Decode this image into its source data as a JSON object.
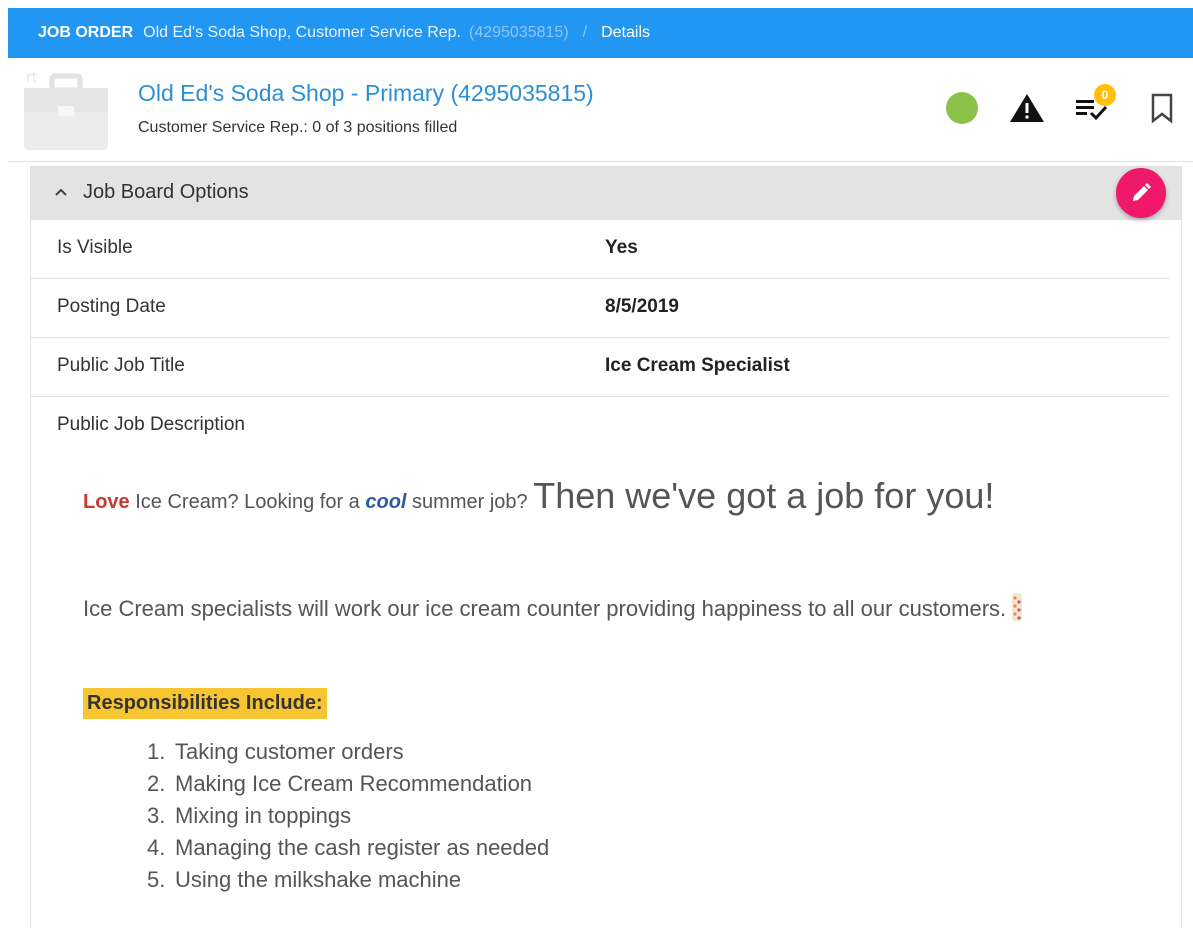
{
  "breadcrumb": {
    "root": "JOB ORDER",
    "entity": "Old Ed's Soda Shop, Customer Service Rep.",
    "id": "(4295035815)",
    "separator": "/",
    "current": "Details"
  },
  "header": {
    "title": "Old Ed's Soda Shop - Primary (4295035815)",
    "subtitle": "Customer Service Rep.: 0 of 3 positions filled",
    "status_color": "#8bc34a",
    "tasks_badge": "0",
    "icons": [
      "briefcase-icon",
      "status-dot",
      "warning-icon",
      "tasks-icon",
      "bookmark-icon"
    ]
  },
  "panel": {
    "title": "Job Board Options",
    "rows": [
      {
        "label": "Is Visible",
        "value": "Yes"
      },
      {
        "label": "Posting Date",
        "value": "8/5/2019"
      },
      {
        "label": "Public Job Title",
        "value": "Ice Cream Specialist"
      }
    ],
    "description_label": "Public Job Description",
    "description": {
      "love": "Love",
      "part1": " Ice Cream? Looking for a ",
      "cool": "cool",
      "part2": " summer job? ",
      "big": "Then we've got a job for you!",
      "paragraph": "Ice Cream specialists will work our ice cream counter providing happiness to all our customers.",
      "responsibilities_heading": "Responsibilities Include:",
      "responsibilities": [
        {
          "num": "1.",
          "text": "Taking customer orders"
        },
        {
          "num": "2.",
          "text": "Making Ice Cream Recommendation"
        },
        {
          "num": "3.",
          "text": "Mixing in toppings"
        },
        {
          "num": "4.",
          "text": "Managing the cash register as needed"
        },
        {
          "num": "5.",
          "text": "Using the milkshake machine"
        }
      ]
    }
  },
  "colors": {
    "breadcrumb_bg": "#2196f3",
    "title_link": "#2a8fd4",
    "fab": "#f0186b",
    "highlight": "#f6c531",
    "love": "#c23b2e",
    "cool": "#2b5aa8"
  }
}
